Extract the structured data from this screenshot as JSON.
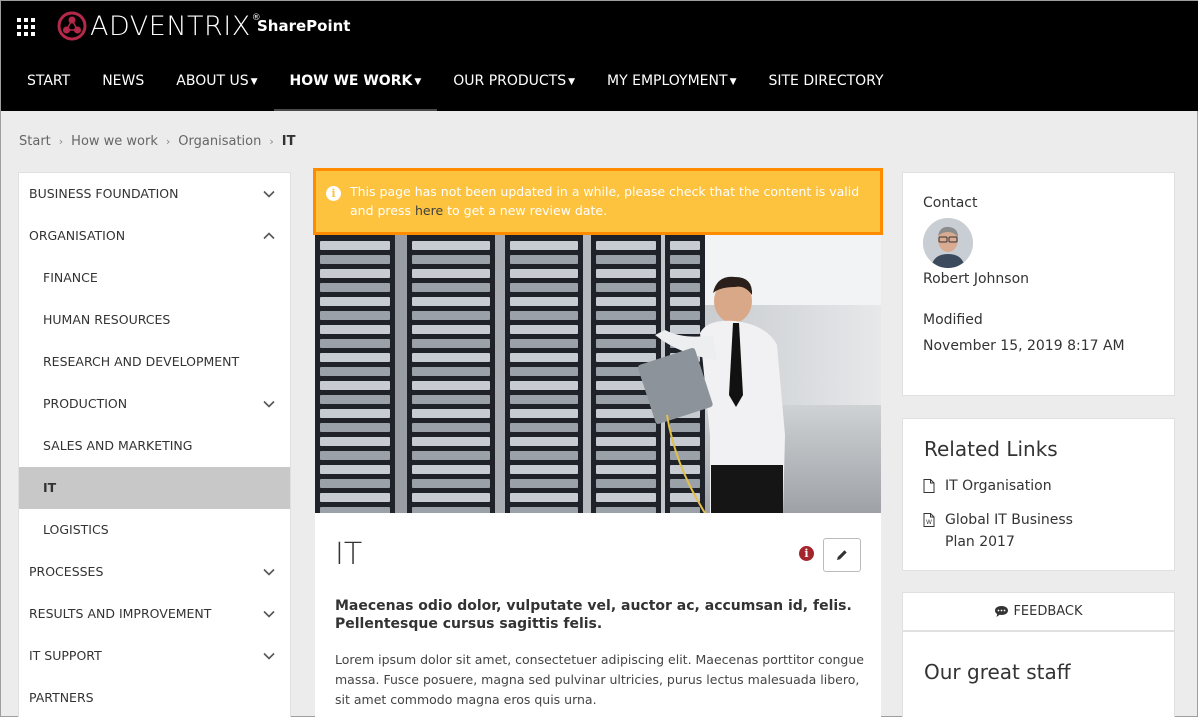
{
  "header": {
    "brand": "ADVENTRIX",
    "brand_mark": "®",
    "site_title": "SharePoint",
    "nav": [
      {
        "label": "START",
        "dropdown": false
      },
      {
        "label": "NEWS",
        "dropdown": false
      },
      {
        "label": "ABOUT US",
        "dropdown": true
      },
      {
        "label": "HOW WE WORK",
        "dropdown": true,
        "active": true
      },
      {
        "label": "OUR PRODUCTS",
        "dropdown": true
      },
      {
        "label": "MY EMPLOYMENT",
        "dropdown": true
      },
      {
        "label": "SITE DIRECTORY",
        "dropdown": false
      }
    ]
  },
  "breadcrumb": [
    "Start",
    "How we work",
    "Organisation",
    "IT"
  ],
  "leftnav": [
    {
      "label": "BUSINESS FOUNDATION",
      "level": 0,
      "chevron": "down"
    },
    {
      "label": "ORGANISATION",
      "level": 0,
      "chevron": "up"
    },
    {
      "label": "FINANCE",
      "level": 1,
      "chevron": "none"
    },
    {
      "label": "HUMAN RESOURCES",
      "level": 1,
      "chevron": "none"
    },
    {
      "label": "RESEARCH AND DEVELOPMENT",
      "level": 1,
      "chevron": "none"
    },
    {
      "label": "PRODUCTION",
      "level": 1,
      "chevron": "down"
    },
    {
      "label": "SALES AND MARKETING",
      "level": 1,
      "chevron": "none"
    },
    {
      "label": "IT",
      "level": 1,
      "chevron": "none",
      "active": true
    },
    {
      "label": "LOGISTICS",
      "level": 1,
      "chevron": "none"
    },
    {
      "label": "PROCESSES",
      "level": 0,
      "chevron": "down"
    },
    {
      "label": "RESULTS AND IMPROVEMENT",
      "level": 0,
      "chevron": "down"
    },
    {
      "label": "IT SUPPORT",
      "level": 0,
      "chevron": "down"
    },
    {
      "label": "PARTNERS",
      "level": 0,
      "chevron": "none"
    }
  ],
  "alert": {
    "text_before": "This page has not been updated in a while, please check that the content is valid and press ",
    "link": "here",
    "text_after": " to get a new review date."
  },
  "page": {
    "title": "IT",
    "lead": "Maecenas odio dolor, vulputate vel, auctor ac, accumsan id, felis. Pellentesque cursus sagittis felis.",
    "body": "Lorem ipsum dolor sit amet, consectetuer adipiscing elit. Maecenas porttitor congue massa. Fusce posuere, magna sed pulvinar ultricies, purus lectus malesuada libero, sit amet commodo magna eros quis urna."
  },
  "contact": {
    "label": "Contact",
    "name": "Robert Johnson",
    "modified_label": "Modified",
    "modified_value": "November 15, 2019 8:17 AM"
  },
  "related": {
    "title": "Related Links",
    "links": [
      {
        "label": "IT Organisation",
        "icon": "document-icon"
      },
      {
        "label": "Global IT Business Plan 2017",
        "icon": "word-document-icon"
      }
    ]
  },
  "feedback": {
    "label": "FEEDBACK",
    "icon": "chat-bubble-icon"
  },
  "staff": {
    "title": "Our great staff"
  },
  "colors": {
    "alert_bg": "#fdc23e",
    "alert_border": "#ff8c00",
    "header_bg": "#000000",
    "brand_red": "#b4284a",
    "info_red": "#a4262c"
  }
}
